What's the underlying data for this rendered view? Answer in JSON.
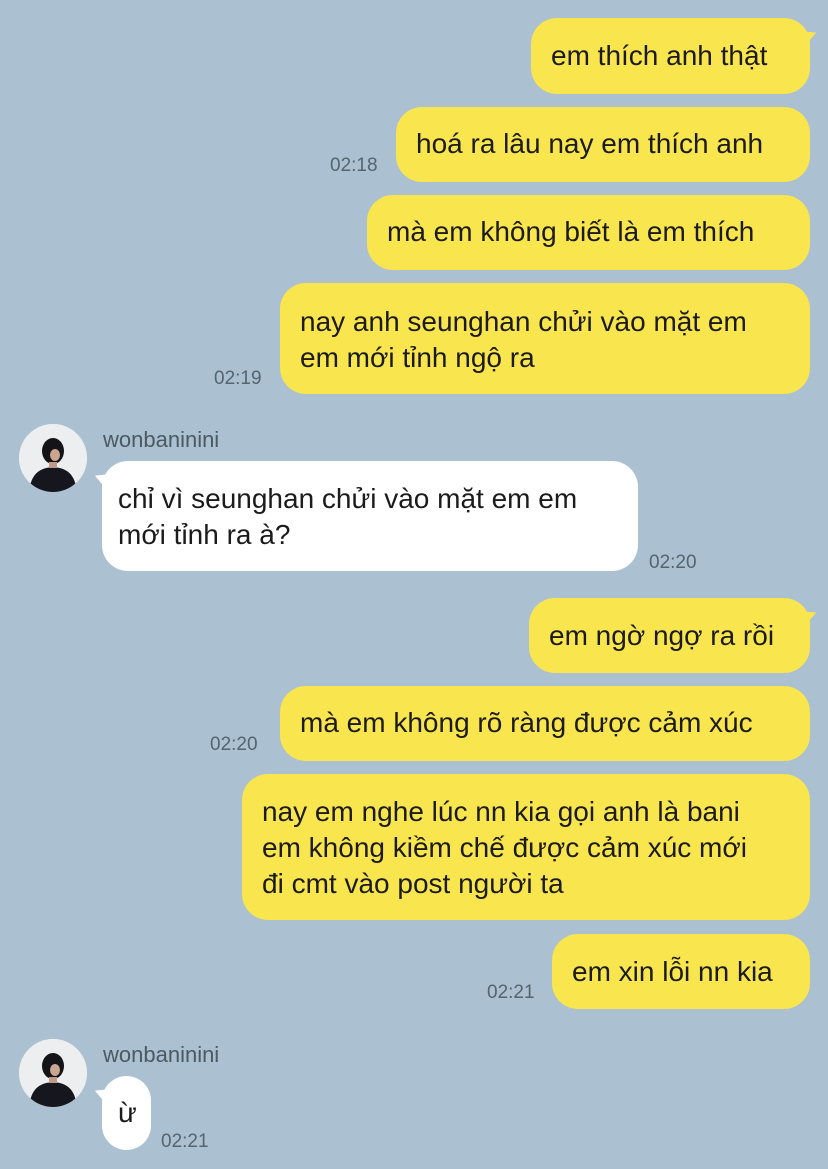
{
  "contact": {
    "name": "wonbaninini"
  },
  "messages": [
    {
      "text": [
        "em thích anh thật"
      ]
    },
    {
      "text": [
        "hoá ra lâu nay em thích anh"
      ],
      "time": "02:18"
    },
    {
      "text": [
        "mà em không biết là em thích"
      ]
    },
    {
      "text": [
        "nay anh seunghan chửi vào mặt em",
        "em mới tỉnh ngộ ra"
      ],
      "time": "02:19"
    },
    {
      "text": [
        "chỉ vì seunghan chửi vào mặt em em",
        "mới tỉnh ra à?"
      ],
      "time": "02:20"
    },
    {
      "text": [
        "em ngờ ngợ ra rồi"
      ]
    },
    {
      "text": [
        "mà em không rõ ràng được cảm xúc"
      ],
      "time": "02:20"
    },
    {
      "text": [
        "nay em nghe lúc nn kia gọi anh là bani",
        "em không kiềm chế được cảm xúc mới",
        "đi cmt vào post người ta"
      ]
    },
    {
      "text": [
        "em xin lỗi nn kia"
      ],
      "time": "02:21"
    },
    {
      "text": [
        "ừ"
      ],
      "time": "02:21"
    }
  ]
}
